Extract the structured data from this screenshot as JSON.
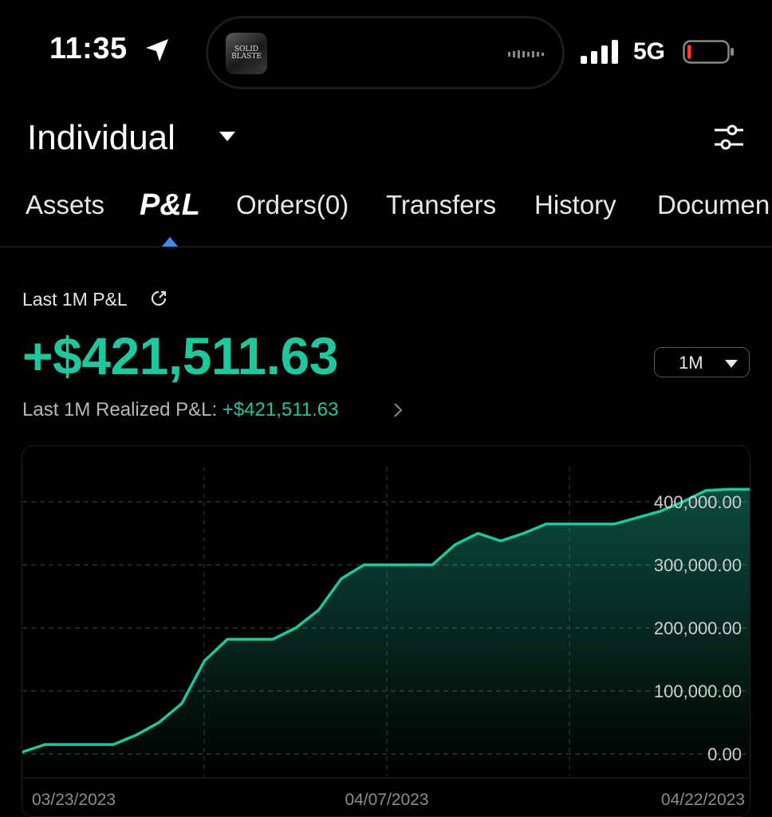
{
  "status_bar": {
    "time": "11:35",
    "network": "5G",
    "location_icon": "location-arrow-icon",
    "island_art_text": "SOLID BLASTE",
    "battery_level": 0.1,
    "battery_color": "#ff3b30"
  },
  "header": {
    "account_name": "Individual",
    "filter_icon": "sliders-icon"
  },
  "tabs": [
    {
      "label": "Assets"
    },
    {
      "label": "P&L",
      "active": true
    },
    {
      "label": "Orders(0)"
    },
    {
      "label": "Transfers"
    },
    {
      "label": "History"
    },
    {
      "label": "Documen"
    }
  ],
  "summary": {
    "label": "Last 1M P&L",
    "value": "+$421,511.63",
    "period": "1M",
    "realized_label": "Last 1M Realized P&L:",
    "realized_value": "+$421,511.63"
  },
  "colors": {
    "accent": "#1fc79f",
    "tab_indicator": "#3d8cf0",
    "background": "#000000"
  },
  "chart_data": {
    "type": "area",
    "y_ticks": [
      "400,000.00",
      "300,000.00",
      "200,000.00",
      "100,000.00",
      "0.00"
    ],
    "x_ticks": [
      "03/23/2023",
      "04/07/2023",
      "04/22/2023"
    ],
    "ylim": [
      0,
      400000
    ],
    "grid": true,
    "series": [
      {
        "values": [
          3000,
          15000,
          15000,
          15000,
          15000,
          30000,
          50000,
          80000,
          148000,
          182000,
          182000,
          182000,
          200000,
          228000,
          278000,
          300000,
          300000,
          300000,
          300000,
          332000,
          350000,
          338000,
          350000,
          365000,
          365000,
          365000,
          365000,
          375000,
          385000,
          400000,
          418000,
          420000,
          420000
        ]
      }
    ]
  }
}
